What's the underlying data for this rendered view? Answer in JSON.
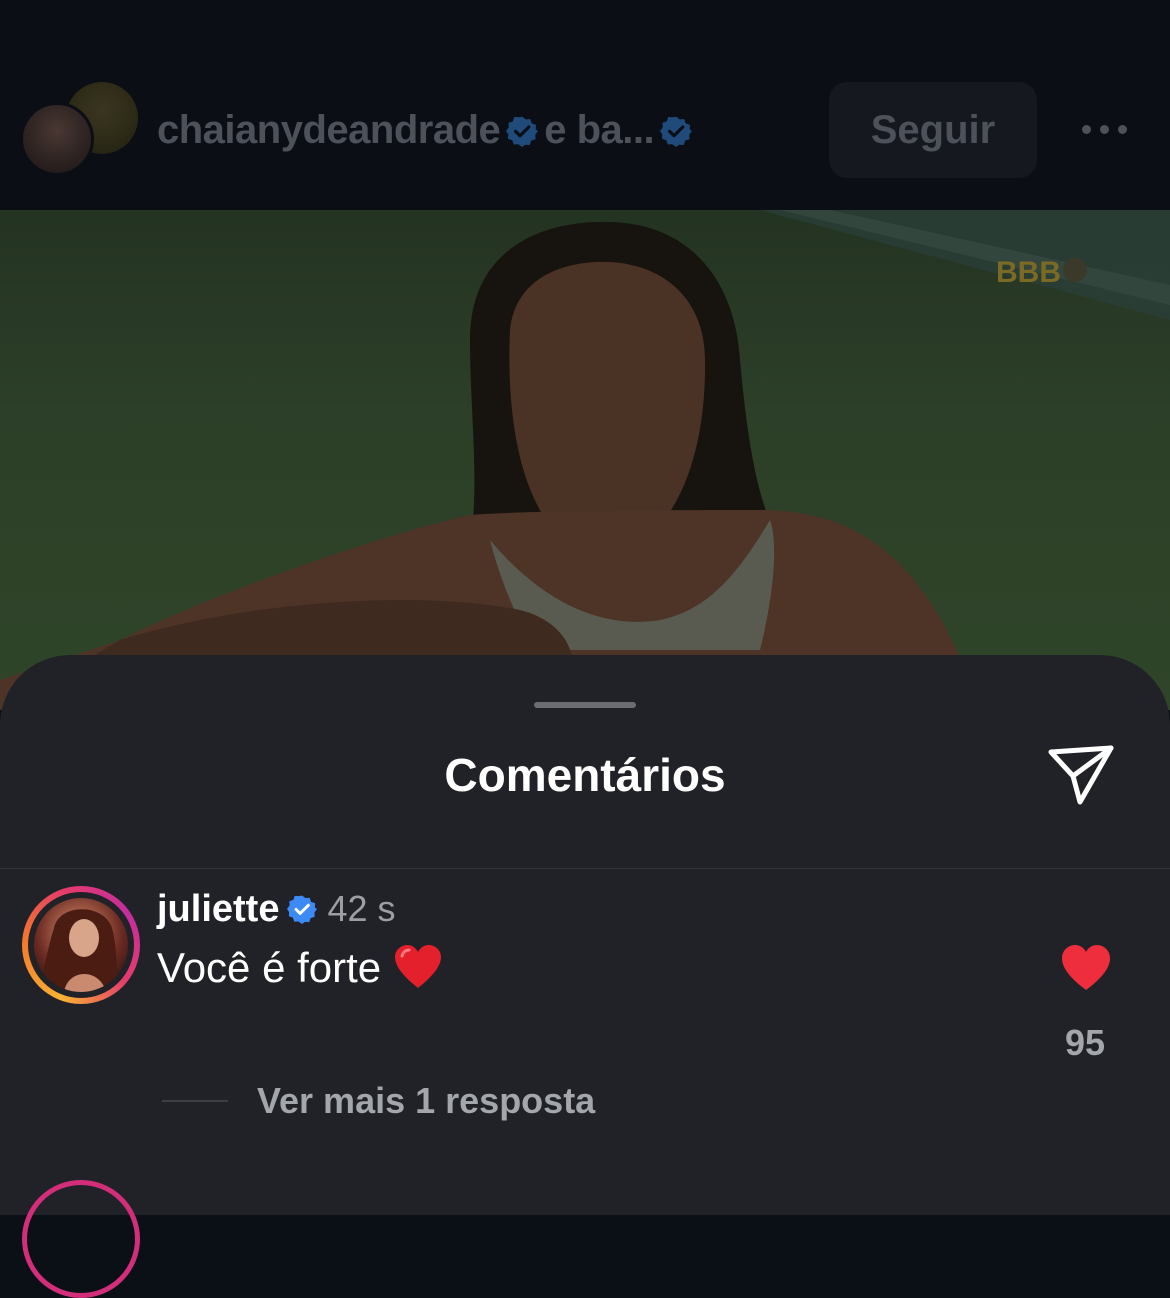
{
  "header": {
    "title_user": "chaianydeandrade",
    "title_connector": "e ba...",
    "follow_label": "Seguir",
    "more_icon": "more-horizontal-icon"
  },
  "video": {
    "watermark": "BBB"
  },
  "comments_sheet": {
    "title": "Comentários",
    "share_icon": "send-icon",
    "comments": [
      {
        "username": "juliette",
        "verified": true,
        "time": "42 s",
        "text": "Você é forte",
        "likes": "95",
        "replies_label": "Ver mais 1 resposta"
      }
    ]
  },
  "colors": {
    "sheet_bg": "#212227",
    "verified_blue": "#3d8af7",
    "like_red": "#ee2e3c",
    "muted_text": "#a3a6ab"
  }
}
